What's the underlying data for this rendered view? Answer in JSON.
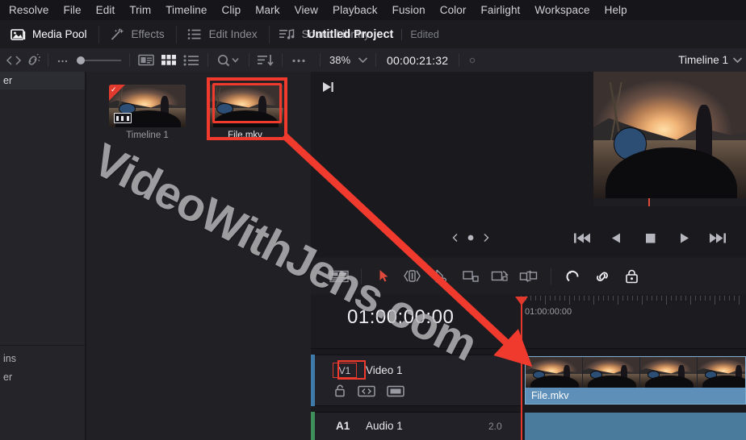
{
  "menu": {
    "items": [
      {
        "label": "Resolve"
      },
      {
        "label": "File"
      },
      {
        "label": "Edit"
      },
      {
        "label": "Trim"
      },
      {
        "label": "Timeline"
      },
      {
        "label": "Clip"
      },
      {
        "label": "Mark"
      },
      {
        "label": "View"
      },
      {
        "label": "Playback"
      },
      {
        "label": "Fusion"
      },
      {
        "label": "Color"
      },
      {
        "label": "Fairlight"
      },
      {
        "label": "Workspace"
      },
      {
        "label": "Help"
      }
    ]
  },
  "pagebar": {
    "buttons": [
      {
        "label": "Media Pool",
        "icon": "media-pool-icon",
        "active": true
      },
      {
        "label": "Effects",
        "icon": "effects-wand-icon",
        "active": false
      },
      {
        "label": "Edit Index",
        "icon": "edit-index-list-icon",
        "active": false
      },
      {
        "label": "Sound Library",
        "icon": "sound-library-icon",
        "active": false
      }
    ],
    "project_title": "Untitled Project",
    "project_status": "Edited"
  },
  "mediapool_toolbar": {
    "icons": [
      "prev-next-arrows-icon",
      "unlink-clip-icon",
      "ellipsis-icon",
      "thumbnail-size-slider-icon",
      "metadata-view-icon",
      "grid-view-icon",
      "list-view-icon",
      "search-icon",
      "sort-order-icon",
      "more-options-icon"
    ],
    "active_view": "grid-view-icon"
  },
  "viewer_toolbar": {
    "zoom_level": "38%",
    "timecode": "00:00:21:32",
    "timeline_name": "Timeline 1"
  },
  "sidebar": {
    "items": [
      {
        "label": "er",
        "selected": true
      }
    ],
    "bottom_items": [
      {
        "label": "ins"
      },
      {
        "label": "er"
      }
    ]
  },
  "mediapool": {
    "clips": [
      {
        "name": "Timeline 1",
        "type": "timeline",
        "selected": false
      },
      {
        "name": "File.mkv",
        "type": "video",
        "selected": true
      }
    ]
  },
  "transport": {
    "buttons": [
      "loop-prev-icon",
      "loop-dot-icon",
      "loop-next-icon",
      "skip-to-start-icon",
      "play-reverse-icon",
      "stop-icon",
      "play-forward-icon",
      "skip-to-end-icon"
    ]
  },
  "timeline_toolbar": {
    "tools": [
      {
        "name": "track-view-options-icon",
        "state": "normal"
      },
      {
        "name": "selection-mode-icon",
        "state": "active"
      },
      {
        "name": "trim-edit-mode-icon",
        "state": "normal"
      },
      {
        "name": "blade-edit-mode-icon",
        "state": "normal"
      },
      {
        "name": "insert-clip-icon",
        "state": "normal"
      },
      {
        "name": "overwrite-clip-icon",
        "state": "normal"
      },
      {
        "name": "replace-clip-icon",
        "state": "normal"
      },
      {
        "name": "snapping-icon",
        "state": "white"
      },
      {
        "name": "link-clips-icon",
        "state": "white"
      },
      {
        "name": "position-lock-icon",
        "state": "white"
      }
    ]
  },
  "timeline": {
    "start_timecode": "01:00:00:00",
    "playhead_timecode": "01:00:00:00",
    "tracks": [
      {
        "id": "V1",
        "name": "Video 1",
        "type": "video",
        "controls": [
          "lock-track-icon",
          "auto-select-icon",
          "video-enable-icon"
        ],
        "clip": {
          "name": "File.mkv"
        }
      },
      {
        "id": "A1",
        "name": "Audio 1",
        "type": "audio",
        "channels": "2.0"
      }
    ]
  },
  "watermark": {
    "text": "VideoWithJens.com"
  },
  "colors": {
    "accent_red": "#f03a2e",
    "playhead_red": "#e2392c",
    "clip_blue": "#5d8fb8",
    "video_track_accent": "#3f7ba8",
    "audio_track_accent": "#3f8f5a",
    "panel_bg": "#1c1c20"
  }
}
